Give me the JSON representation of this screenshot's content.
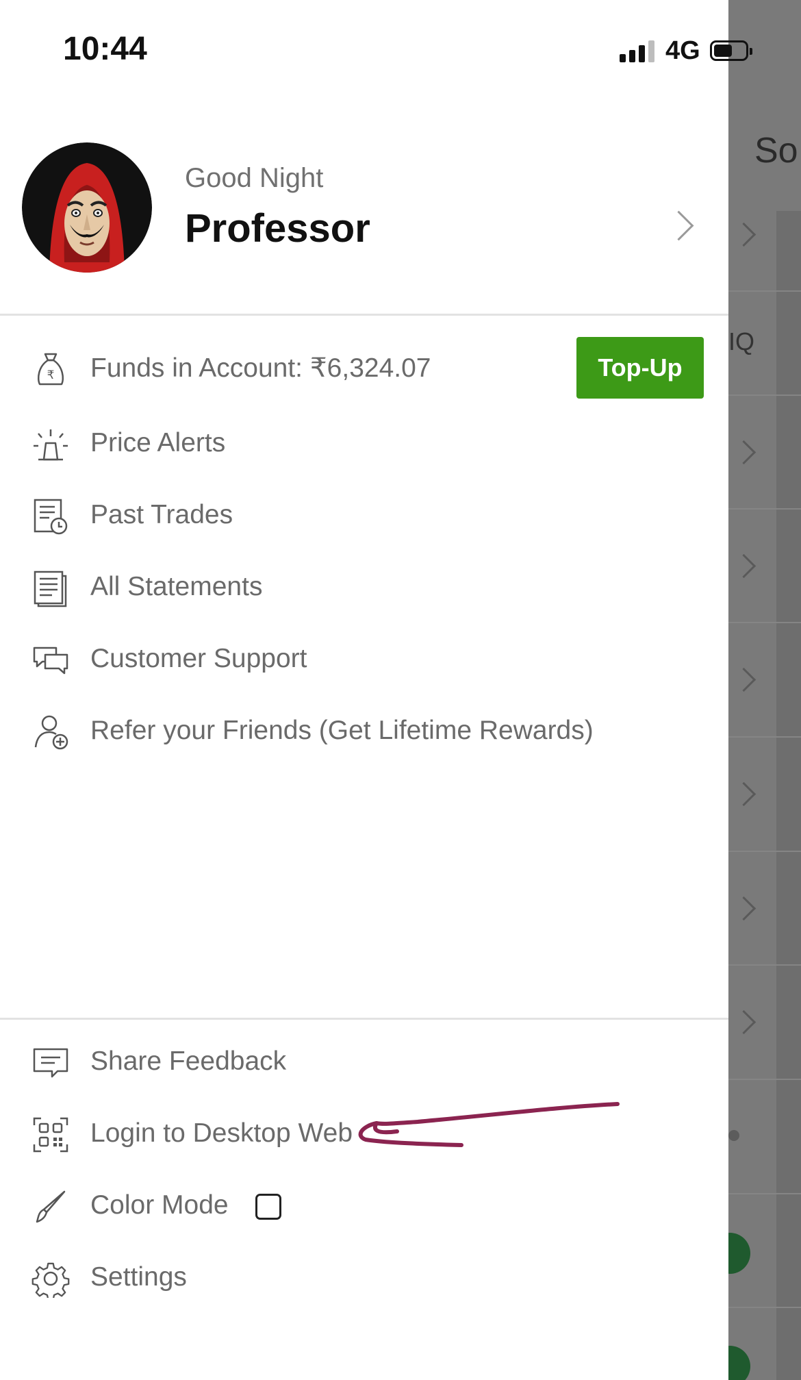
{
  "status_bar": {
    "time": "10:44",
    "network": "4G"
  },
  "profile": {
    "greeting": "Good Night",
    "name": "Professor"
  },
  "menu_top": [
    {
      "label": "Funds in Account: ₹6,324.07",
      "icon": "money-bag-icon"
    },
    {
      "label": "Price Alerts",
      "icon": "alarm-light-icon"
    },
    {
      "label": "Past Trades",
      "icon": "trade-history-icon"
    },
    {
      "label": "All Statements",
      "icon": "statements-icon"
    },
    {
      "label": "Customer Support",
      "icon": "chat-bubbles-icon"
    },
    {
      "label": "Refer your Friends (Get Lifetime Rewards)",
      "icon": "add-user-icon"
    }
  ],
  "topup_label": "Top-Up",
  "menu_bottom": [
    {
      "label": "Share Feedback",
      "icon": "feedback-icon"
    },
    {
      "label": "Login to Desktop Web",
      "icon": "qr-code-icon"
    },
    {
      "label": "Color Mode",
      "icon": "brush-icon"
    },
    {
      "label": "Settings",
      "icon": "gear-icon"
    }
  ],
  "background": {
    "title_fragment": "So",
    "label_fragment": "IQ"
  },
  "colors": {
    "accent": "#3d9a17",
    "annotation": "#8b2450",
    "text": "#6a6a6a"
  }
}
